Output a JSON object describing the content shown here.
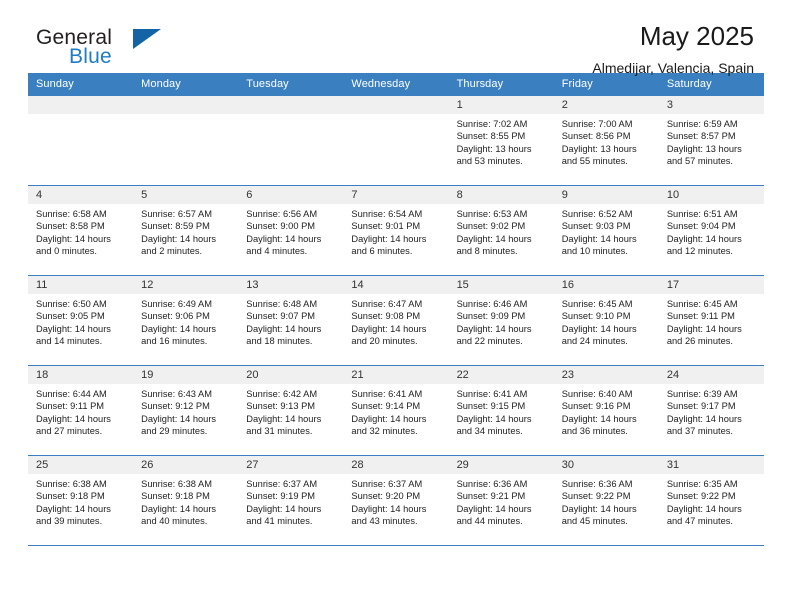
{
  "brand": {
    "word1": "General",
    "word2": "Blue",
    "logo_icon": "blue-triangle-logo"
  },
  "header": {
    "title": "May 2025",
    "subtitle": "Almedijar, Valencia, Spain"
  },
  "colors": {
    "header_blue": "#3a80c1",
    "brand_blue": "#1f7cc4",
    "daynum_band": "#f0f0f0",
    "text": "#222222"
  },
  "calendar": {
    "weekday_headers": [
      "Sunday",
      "Monday",
      "Tuesday",
      "Wednesday",
      "Thursday",
      "Friday",
      "Saturday"
    ],
    "weeks": [
      [
        {
          "empty": true
        },
        {
          "empty": true
        },
        {
          "empty": true
        },
        {
          "empty": true
        },
        {
          "day": "1",
          "sunrise": "Sunrise: 7:02 AM",
          "sunset": "Sunset: 8:55 PM",
          "daylight_1": "Daylight: 13 hours",
          "daylight_2": "and 53 minutes."
        },
        {
          "day": "2",
          "sunrise": "Sunrise: 7:00 AM",
          "sunset": "Sunset: 8:56 PM",
          "daylight_1": "Daylight: 13 hours",
          "daylight_2": "and 55 minutes."
        },
        {
          "day": "3",
          "sunrise": "Sunrise: 6:59 AM",
          "sunset": "Sunset: 8:57 PM",
          "daylight_1": "Daylight: 13 hours",
          "daylight_2": "and 57 minutes."
        }
      ],
      [
        {
          "day": "4",
          "sunrise": "Sunrise: 6:58 AM",
          "sunset": "Sunset: 8:58 PM",
          "daylight_1": "Daylight: 14 hours",
          "daylight_2": "and 0 minutes."
        },
        {
          "day": "5",
          "sunrise": "Sunrise: 6:57 AM",
          "sunset": "Sunset: 8:59 PM",
          "daylight_1": "Daylight: 14 hours",
          "daylight_2": "and 2 minutes."
        },
        {
          "day": "6",
          "sunrise": "Sunrise: 6:56 AM",
          "sunset": "Sunset: 9:00 PM",
          "daylight_1": "Daylight: 14 hours",
          "daylight_2": "and 4 minutes."
        },
        {
          "day": "7",
          "sunrise": "Sunrise: 6:54 AM",
          "sunset": "Sunset: 9:01 PM",
          "daylight_1": "Daylight: 14 hours",
          "daylight_2": "and 6 minutes."
        },
        {
          "day": "8",
          "sunrise": "Sunrise: 6:53 AM",
          "sunset": "Sunset: 9:02 PM",
          "daylight_1": "Daylight: 14 hours",
          "daylight_2": "and 8 minutes."
        },
        {
          "day": "9",
          "sunrise": "Sunrise: 6:52 AM",
          "sunset": "Sunset: 9:03 PM",
          "daylight_1": "Daylight: 14 hours",
          "daylight_2": "and 10 minutes."
        },
        {
          "day": "10",
          "sunrise": "Sunrise: 6:51 AM",
          "sunset": "Sunset: 9:04 PM",
          "daylight_1": "Daylight: 14 hours",
          "daylight_2": "and 12 minutes."
        }
      ],
      [
        {
          "day": "11",
          "sunrise": "Sunrise: 6:50 AM",
          "sunset": "Sunset: 9:05 PM",
          "daylight_1": "Daylight: 14 hours",
          "daylight_2": "and 14 minutes."
        },
        {
          "day": "12",
          "sunrise": "Sunrise: 6:49 AM",
          "sunset": "Sunset: 9:06 PM",
          "daylight_1": "Daylight: 14 hours",
          "daylight_2": "and 16 minutes."
        },
        {
          "day": "13",
          "sunrise": "Sunrise: 6:48 AM",
          "sunset": "Sunset: 9:07 PM",
          "daylight_1": "Daylight: 14 hours",
          "daylight_2": "and 18 minutes."
        },
        {
          "day": "14",
          "sunrise": "Sunrise: 6:47 AM",
          "sunset": "Sunset: 9:08 PM",
          "daylight_1": "Daylight: 14 hours",
          "daylight_2": "and 20 minutes."
        },
        {
          "day": "15",
          "sunrise": "Sunrise: 6:46 AM",
          "sunset": "Sunset: 9:09 PM",
          "daylight_1": "Daylight: 14 hours",
          "daylight_2": "and 22 minutes."
        },
        {
          "day": "16",
          "sunrise": "Sunrise: 6:45 AM",
          "sunset": "Sunset: 9:10 PM",
          "daylight_1": "Daylight: 14 hours",
          "daylight_2": "and 24 minutes."
        },
        {
          "day": "17",
          "sunrise": "Sunrise: 6:45 AM",
          "sunset": "Sunset: 9:11 PM",
          "daylight_1": "Daylight: 14 hours",
          "daylight_2": "and 26 minutes."
        }
      ],
      [
        {
          "day": "18",
          "sunrise": "Sunrise: 6:44 AM",
          "sunset": "Sunset: 9:11 PM",
          "daylight_1": "Daylight: 14 hours",
          "daylight_2": "and 27 minutes."
        },
        {
          "day": "19",
          "sunrise": "Sunrise: 6:43 AM",
          "sunset": "Sunset: 9:12 PM",
          "daylight_1": "Daylight: 14 hours",
          "daylight_2": "and 29 minutes."
        },
        {
          "day": "20",
          "sunrise": "Sunrise: 6:42 AM",
          "sunset": "Sunset: 9:13 PM",
          "daylight_1": "Daylight: 14 hours",
          "daylight_2": "and 31 minutes."
        },
        {
          "day": "21",
          "sunrise": "Sunrise: 6:41 AM",
          "sunset": "Sunset: 9:14 PM",
          "daylight_1": "Daylight: 14 hours",
          "daylight_2": "and 32 minutes."
        },
        {
          "day": "22",
          "sunrise": "Sunrise: 6:41 AM",
          "sunset": "Sunset: 9:15 PM",
          "daylight_1": "Daylight: 14 hours",
          "daylight_2": "and 34 minutes."
        },
        {
          "day": "23",
          "sunrise": "Sunrise: 6:40 AM",
          "sunset": "Sunset: 9:16 PM",
          "daylight_1": "Daylight: 14 hours",
          "daylight_2": "and 36 minutes."
        },
        {
          "day": "24",
          "sunrise": "Sunrise: 6:39 AM",
          "sunset": "Sunset: 9:17 PM",
          "daylight_1": "Daylight: 14 hours",
          "daylight_2": "and 37 minutes."
        }
      ],
      [
        {
          "day": "25",
          "sunrise": "Sunrise: 6:38 AM",
          "sunset": "Sunset: 9:18 PM",
          "daylight_1": "Daylight: 14 hours",
          "daylight_2": "and 39 minutes."
        },
        {
          "day": "26",
          "sunrise": "Sunrise: 6:38 AM",
          "sunset": "Sunset: 9:18 PM",
          "daylight_1": "Daylight: 14 hours",
          "daylight_2": "and 40 minutes."
        },
        {
          "day": "27",
          "sunrise": "Sunrise: 6:37 AM",
          "sunset": "Sunset: 9:19 PM",
          "daylight_1": "Daylight: 14 hours",
          "daylight_2": "and 41 minutes."
        },
        {
          "day": "28",
          "sunrise": "Sunrise: 6:37 AM",
          "sunset": "Sunset: 9:20 PM",
          "daylight_1": "Daylight: 14 hours",
          "daylight_2": "and 43 minutes."
        },
        {
          "day": "29",
          "sunrise": "Sunrise: 6:36 AM",
          "sunset": "Sunset: 9:21 PM",
          "daylight_1": "Daylight: 14 hours",
          "daylight_2": "and 44 minutes."
        },
        {
          "day": "30",
          "sunrise": "Sunrise: 6:36 AM",
          "sunset": "Sunset: 9:22 PM",
          "daylight_1": "Daylight: 14 hours",
          "daylight_2": "and 45 minutes."
        },
        {
          "day": "31",
          "sunrise": "Sunrise: 6:35 AM",
          "sunset": "Sunset: 9:22 PM",
          "daylight_1": "Daylight: 14 hours",
          "daylight_2": "and 47 minutes."
        }
      ]
    ]
  }
}
